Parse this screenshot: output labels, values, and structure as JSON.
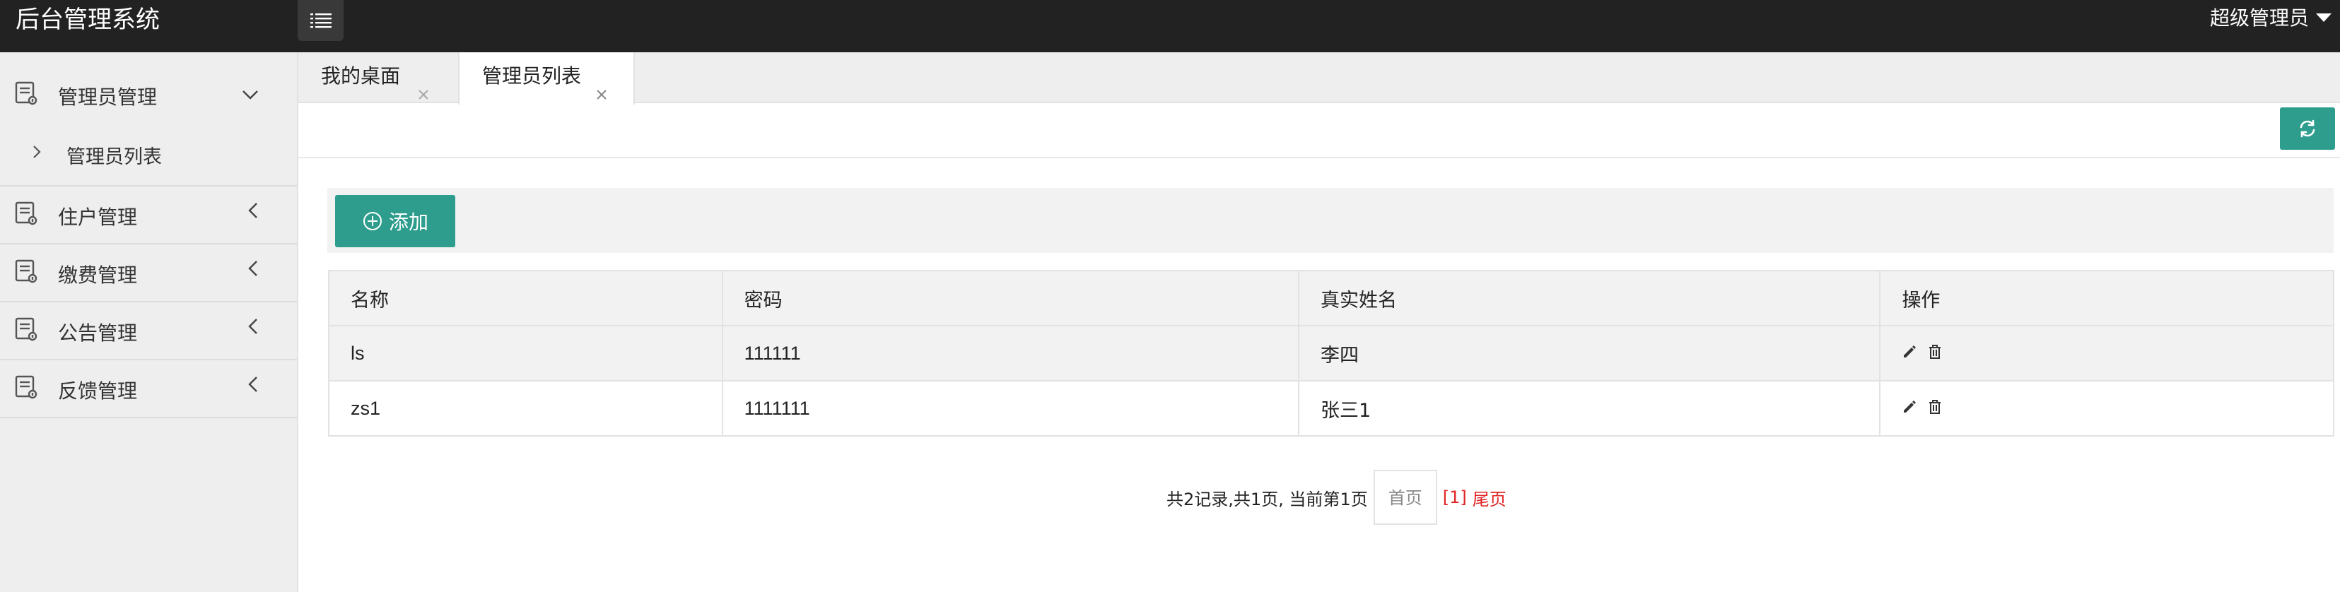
{
  "header": {
    "brand": "后台管理系统",
    "menu_toggle_icon": "list-icon",
    "user": "超级管理员"
  },
  "sidebar": {
    "groups": [
      {
        "label": "管理员管理",
        "icon": "document-icon",
        "expanded": true,
        "children": [
          {
            "label": "管理员列表"
          }
        ]
      },
      {
        "label": "住户管理",
        "icon": "document-icon",
        "expanded": false
      },
      {
        "label": "缴费管理",
        "icon": "document-icon",
        "expanded": false
      },
      {
        "label": "公告管理",
        "icon": "document-icon",
        "expanded": false
      },
      {
        "label": "反馈管理",
        "icon": "document-icon",
        "expanded": false
      }
    ]
  },
  "tabs": [
    {
      "label": "我的桌面",
      "active": false
    },
    {
      "label": "管理员列表",
      "active": true
    }
  ],
  "toolbar": {
    "refresh_icon": "refresh-icon",
    "add_label": "添加"
  },
  "table": {
    "columns": [
      "名称",
      "密码",
      "真实姓名",
      "操作"
    ],
    "rows": [
      {
        "name": "ls",
        "password": "111111",
        "real_name": "李四"
      },
      {
        "name": "zs1",
        "password": "1111111",
        "real_name": "张三1"
      }
    ]
  },
  "pager": {
    "summary": "共2记录,共1页, 当前第1页",
    "first": "首页",
    "current": "[1]",
    "last": "尾页"
  },
  "colors": {
    "header_bg": "#222222",
    "sidebar_bg": "#eeeeee",
    "accent": "#2e9d8d",
    "pager_active": "#e02424"
  }
}
